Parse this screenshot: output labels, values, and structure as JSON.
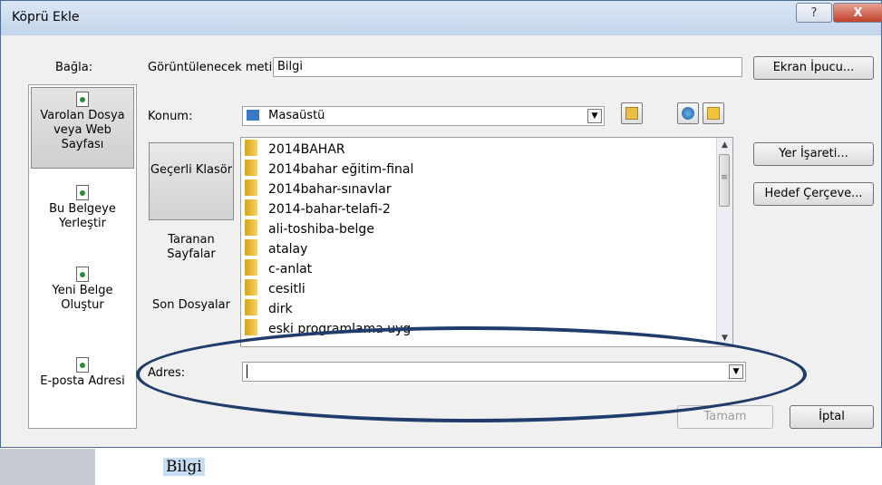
{
  "dialog": {
    "title": "Köprü Ekle",
    "help_label": "?",
    "close_label": "X"
  },
  "linkbar": {
    "header": "Bağla:",
    "items": [
      {
        "label": "Varolan Dosya veya Web Sayfası",
        "icon": "existing-file-icon"
      },
      {
        "label": "Bu Belgeye Yerleştir",
        "icon": "place-in-document-icon"
      },
      {
        "label": "Yeni Belge Oluştur",
        "icon": "new-document-icon"
      },
      {
        "label": "E-posta Adresi",
        "icon": "email-address-icon"
      }
    ]
  },
  "display_text": {
    "label": "Görüntülenecek metin:",
    "value": "Bilgi"
  },
  "screen_tip_button": "Ekran İpucu...",
  "location": {
    "label": "Konum:",
    "value": "Masaüstü"
  },
  "sidepanel": {
    "items": [
      {
        "label": "Geçerli Klasör"
      },
      {
        "label": "Taranan Sayfalar"
      },
      {
        "label": "Son Dosyalar"
      }
    ]
  },
  "files": [
    "2014BAHAR",
    "2014bahar eğitim-final",
    "2014bahar-sınavlar",
    "2014-bahar-telafi-2",
    "ali-toshiba-belge",
    "atalay",
    "c-anlat",
    "cesitli",
    "dirk",
    "eski programlama uyg"
  ],
  "bookmark_button": "Yer İşareti...",
  "target_frame_button": "Hedef Çerçeve...",
  "address": {
    "label": "Adres:",
    "value": ""
  },
  "ok_button": "Tamam",
  "cancel_button": "İptal",
  "document_text": "Bilgi"
}
